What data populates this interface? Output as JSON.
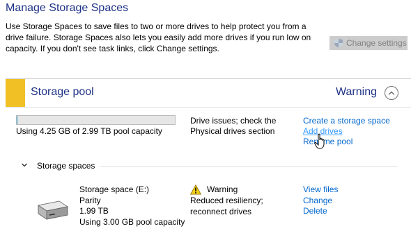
{
  "header": {
    "title": "Manage Storage Spaces",
    "description": "Use Storage Spaces to save files to two or more drives to help protect you from a drive failure. Storage Spaces also lets you easily add more drives if you run low on capacity. If you don't see task links, click Change settings.",
    "change_settings_label": "Change settings"
  },
  "pool": {
    "title": "Storage pool",
    "status": "Warning",
    "capacity_used_fraction": 0.0014,
    "capacity_text": "Using 4.25 GB of 2.99 TB pool capacity",
    "issues_text": "Drive issues; check the Physical drives section",
    "links": {
      "create": "Create a storage space",
      "add_drives": "Add drives",
      "rename": "Rename pool"
    }
  },
  "spaces": {
    "label": "Storage spaces",
    "items": [
      {
        "name": "Storage space (E:)",
        "resiliency_type": "Parity",
        "size": "1.99 TB",
        "usage": "Using 3.00 GB pool capacity",
        "status": "Warning",
        "status_detail": "Reduced resiliency; reconnect drives",
        "links": {
          "view_files": "View files",
          "change": "Change",
          "delete": "Delete"
        }
      }
    ]
  },
  "colors": {
    "title_blue": "#1e3287",
    "link_blue": "#0066cc",
    "warning_accent": "#f0c024",
    "button_disabled_bg": "#cccccc"
  }
}
